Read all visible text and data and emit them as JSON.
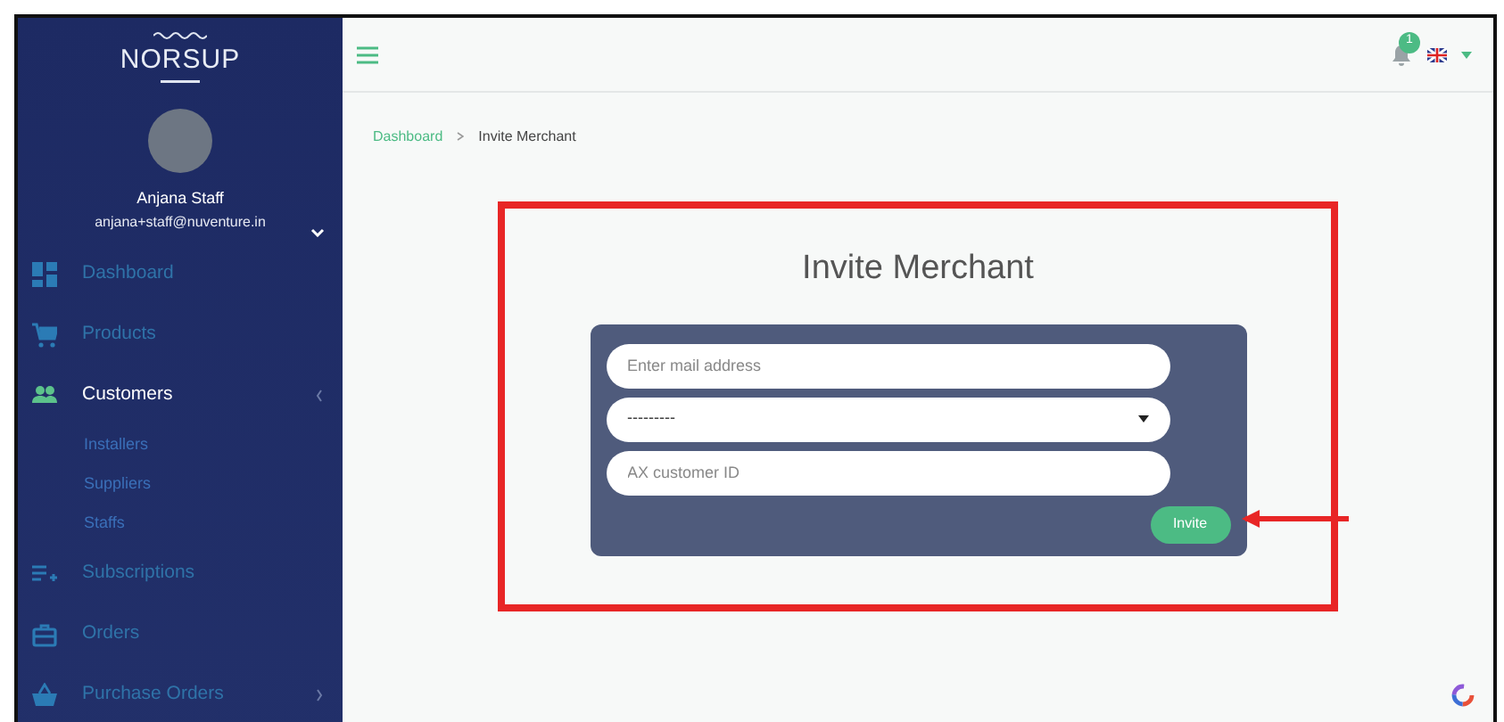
{
  "sidebar": {
    "logo": "NORSUP",
    "user": {
      "name": "Anjana Staff",
      "email": "anjana+staff@nuventure.in"
    },
    "items": [
      {
        "label": "Dashboard",
        "selected": false
      },
      {
        "label": "Products",
        "selected": false
      },
      {
        "label": "Customers",
        "selected": true,
        "expanded": true,
        "children": [
          {
            "label": "Installers",
            "selected": false
          },
          {
            "label": "Suppliers",
            "selected": false
          },
          {
            "label": "Staffs",
            "selected": false
          }
        ]
      },
      {
        "label": "Subscriptions",
        "selected": false
      },
      {
        "label": "Orders",
        "selected": false
      },
      {
        "label": "Purchase Orders",
        "selected": false,
        "expanded": false
      }
    ]
  },
  "header": {
    "notification_count": "1"
  },
  "breadcrumb": [
    {
      "label": "Dashboard",
      "selected": false
    },
    {
      "label": "Invite Merchant",
      "selected": true
    }
  ],
  "form": {
    "title": "Invite Merchant",
    "fields": [
      {
        "kind": "text",
        "placeholder": "Enter mail address"
      },
      {
        "kind": "select",
        "value": "---------"
      },
      {
        "kind": "text",
        "placeholder": "AX customer ID"
      }
    ],
    "button": "Invite"
  }
}
